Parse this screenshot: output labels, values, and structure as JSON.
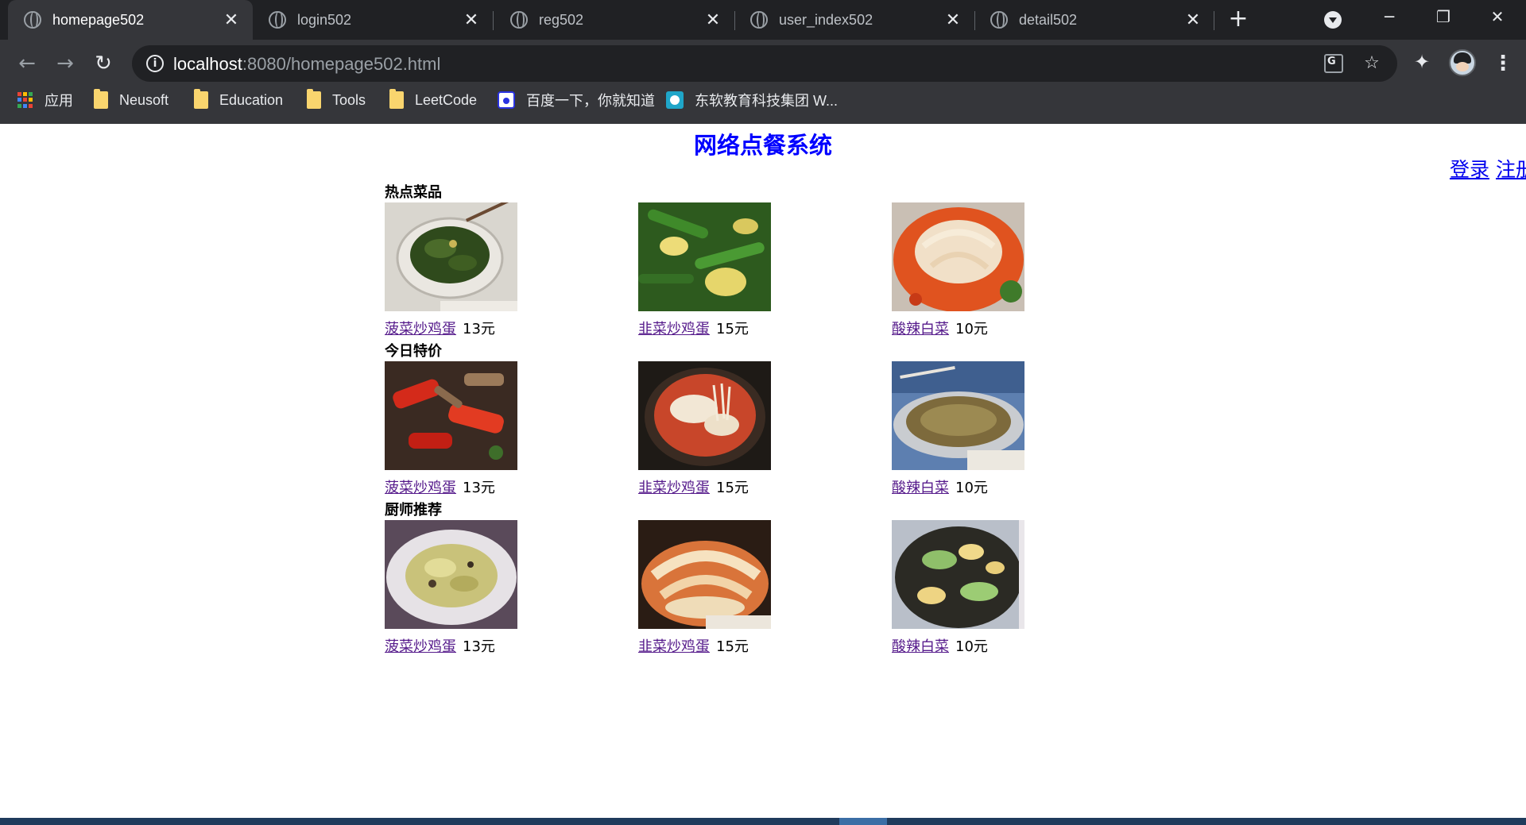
{
  "browser": {
    "tabs": [
      {
        "label": "homepage502",
        "active": true
      },
      {
        "label": "login502",
        "active": false
      },
      {
        "label": "reg502",
        "active": false
      },
      {
        "label": "user_index502",
        "active": false
      },
      {
        "label": "detail502",
        "active": false
      }
    ],
    "close_glyph": "✕",
    "newtab_glyph": "+",
    "window": {
      "minimize": "─",
      "restore": "❐",
      "close": "✕"
    },
    "url_host": "localhost",
    "url_rest": ":8080/homepage502.html",
    "nav": {
      "back": "←",
      "forward": "→",
      "reload": "↻"
    },
    "star_glyph": "☆",
    "extensions_glyph": "✦",
    "menu_glyph": "⋮",
    "info_glyph": "i",
    "bookmarks": [
      {
        "label": "应用",
        "icon": "apps-icon"
      },
      {
        "label": "Neusoft",
        "icon": "folder-icon"
      },
      {
        "label": "Education",
        "icon": "folder-icon"
      },
      {
        "label": "Tools",
        "icon": "folder-icon"
      },
      {
        "label": "LeetCode",
        "icon": "folder-icon"
      },
      {
        "label": "百度一下，你就知道",
        "icon": "baidu-icon"
      },
      {
        "label": "东软教育科技集团 W...",
        "icon": "neusoft-icon"
      }
    ],
    "apps_colors": [
      "#ea4335",
      "#fbbc05",
      "#34a853",
      "#4285f4",
      "#ea4335",
      "#fbbc05",
      "#34a853",
      "#4285f4",
      "#ea4335"
    ]
  },
  "page": {
    "title": "网络点餐系统",
    "login_link": "登录",
    "register_link": "注册",
    "link_color": "#0000ee",
    "title_color": "#0000ff",
    "visited_color": "#551a8b",
    "sections": [
      {
        "heading": "热点菜品",
        "dishes": [
          {
            "name": "菠菜炒鸡蛋",
            "price": "13元",
            "image": "spinach-eggs-photo"
          },
          {
            "name": "韭菜炒鸡蛋",
            "price": "15元",
            "image": "chive-eggs-photo"
          },
          {
            "name": "酸辣白菜",
            "price": "10元",
            "image": "spicy-cabbage-photo"
          }
        ]
      },
      {
        "heading": "今日特价",
        "dishes": [
          {
            "name": "菠菜炒鸡蛋",
            "price": "13元",
            "image": "pepper-stirfry-photo"
          },
          {
            "name": "韭菜炒鸡蛋",
            "price": "15元",
            "image": "mushroom-soup-photo"
          },
          {
            "name": "酸辣白菜",
            "price": "10元",
            "image": "fish-soup-photo"
          }
        ]
      },
      {
        "heading": "厨师推荐",
        "dishes": [
          {
            "name": "菠菜炒鸡蛋",
            "price": "13元",
            "image": "cabbage-plate-photo"
          },
          {
            "name": "韭菜炒鸡蛋",
            "price": "15元",
            "image": "pickled-cabbage-photo"
          },
          {
            "name": "酸辣白菜",
            "price": "10元",
            "image": "cucumber-fungus-photo"
          }
        ]
      }
    ]
  }
}
